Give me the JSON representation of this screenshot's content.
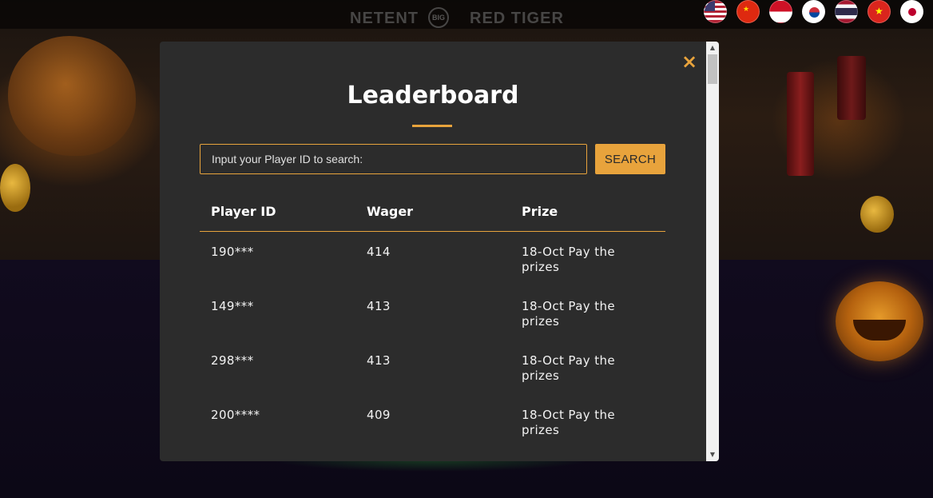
{
  "header": {
    "brands": [
      "NETENT",
      "BIG",
      "RED TIGER"
    ],
    "flags": [
      {
        "name": "us-flag-icon",
        "colors": [
          "#b22234",
          "#ffffff",
          "#3c3b6e"
        ]
      },
      {
        "name": "china-flag-icon",
        "colors": [
          "#de2910",
          "#ffde00"
        ]
      },
      {
        "name": "indonesia-flag-icon",
        "colors": [
          "#ce1126",
          "#ffffff"
        ]
      },
      {
        "name": "korea-flag-icon",
        "colors": [
          "#ffffff",
          "#cd2e3a",
          "#0047a0"
        ]
      },
      {
        "name": "thailand-flag-icon",
        "colors": [
          "#a51931",
          "#f4f5f8",
          "#2d2a4a"
        ]
      },
      {
        "name": "vietnam-flag-icon",
        "colors": [
          "#da251d",
          "#ffff00"
        ]
      },
      {
        "name": "japan-flag-icon",
        "colors": [
          "#ffffff",
          "#bc002d"
        ]
      }
    ]
  },
  "modal": {
    "close_icon": "×",
    "title": "Leaderboard",
    "search": {
      "placeholder": "Input your Player ID to search:",
      "value": "",
      "button_label": "SEARCH"
    },
    "table": {
      "headers": [
        "Player ID",
        "Wager",
        "Prize"
      ],
      "rows": [
        {
          "player_id": "190***",
          "wager": "414",
          "prize": "18-Oct Pay the prizes"
        },
        {
          "player_id": "149***",
          "wager": "413",
          "prize": "18-Oct Pay the prizes"
        },
        {
          "player_id": "298***",
          "wager": "413",
          "prize": "18-Oct Pay the prizes"
        },
        {
          "player_id": "200****",
          "wager": "409",
          "prize": "18-Oct Pay the prizes"
        }
      ]
    }
  },
  "colors": {
    "accent": "#e8a33c",
    "modal_bg": "#2c2c2c",
    "text": "#ffffff"
  }
}
